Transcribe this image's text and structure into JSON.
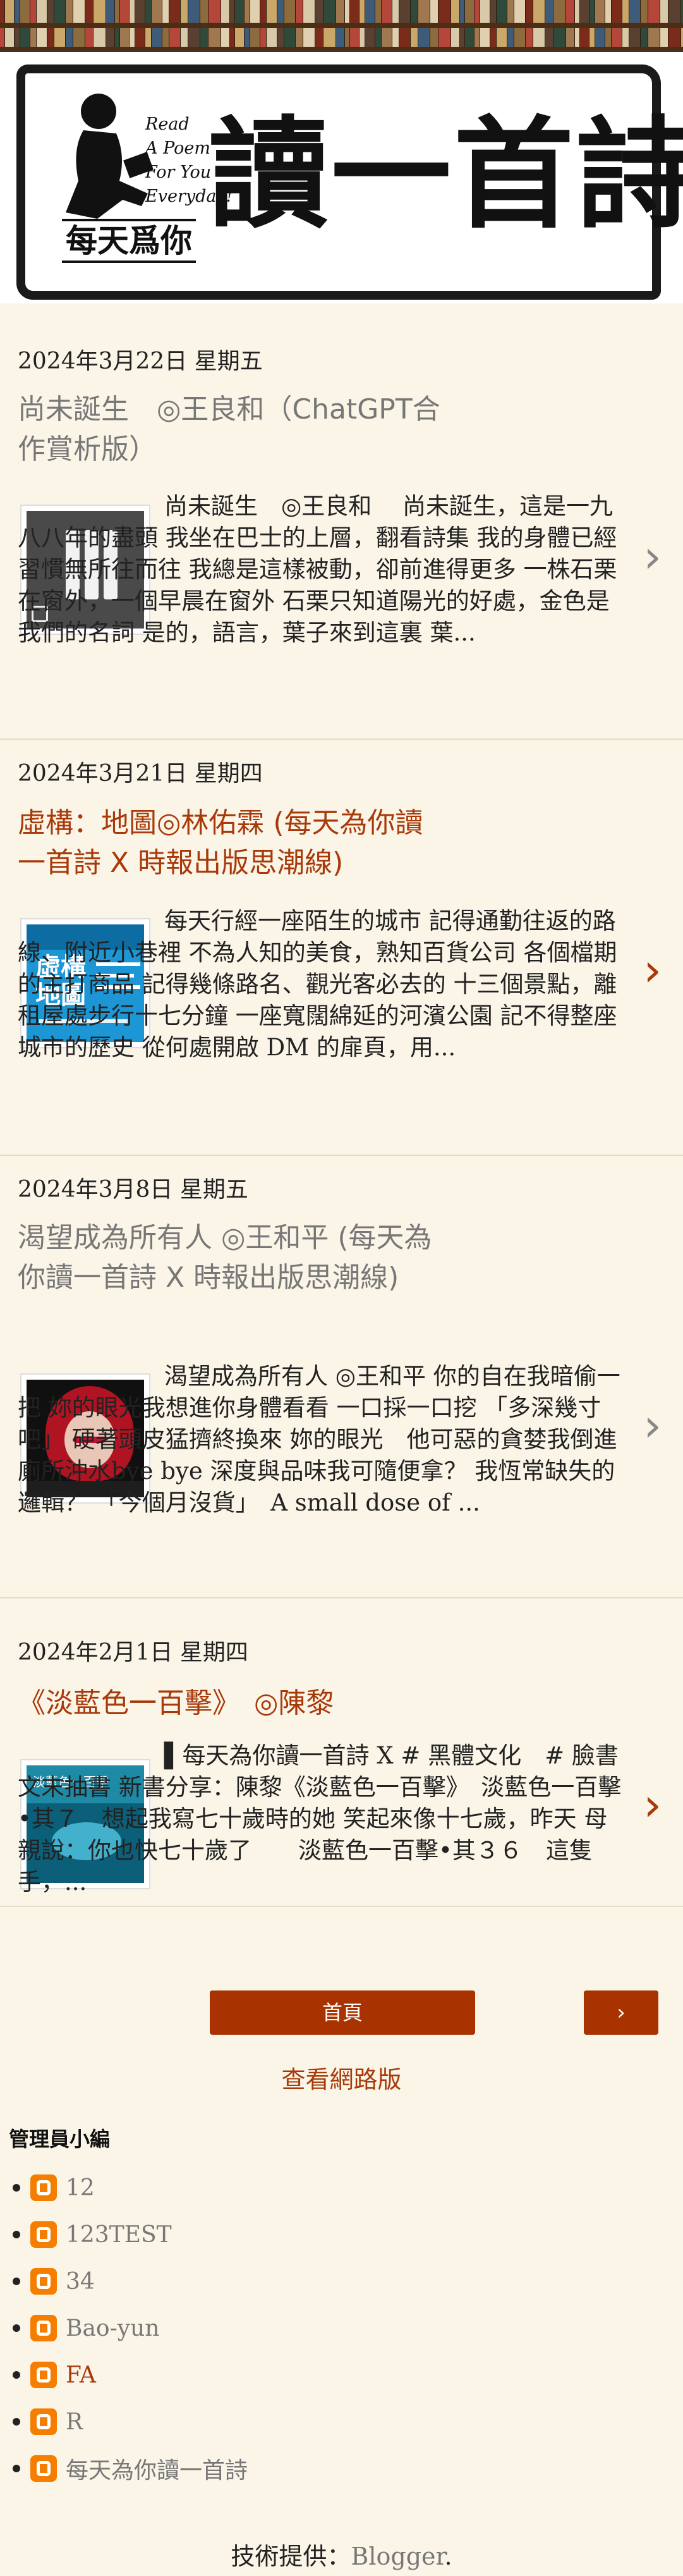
{
  "header": {
    "poem_lines": [
      "Read",
      "A Poem",
      "For You",
      "Everyday!"
    ],
    "title_big": "讀一首詩",
    "title_sub": "每天爲你"
  },
  "posts": [
    {
      "date": "2024年3月22日 星期五",
      "title": "尚未誕生　◎王良和（ChatGPT合作賞析版）",
      "snippet": "尚未誕生　◎王良和　 尚未誕生，這是一九八八年的盡頭 我坐在巴士的上層，翻看詩集 我的身體已經習慣無所往而往 我總是這樣被動，卻前進得更多 一株石栗在窗外，一個早晨在窗外 石栗只知道陽光的好處，金色是我們的名詞 是的，語言，葉子來到這裏 葉..."
    },
    {
      "date": "2024年3月21日 星期四",
      "title": "虛構：地圖◎林佑霖 (每天為你讀一首詩 X 時報出版思潮線)",
      "snippet": "每天行經一座陌生的城市 記得通勤往返的路線、附近小巷裡 不為人知的美食，熟知百貨公司 各個檔期的主打商品 記得幾條路名、觀光客必去的 十三個景點，離租屋處步行十七分鐘 一座寬闊綿延的河濱公園 記不得整座城市的歷史 從何處開啟 DM 的扉頁，用..."
    },
    {
      "date": "2024年3月8日 星期五",
      "title": "渴望成為所有人 ◎王和平 (每天為你讀一首詩 X 時報出版思潮線)",
      "snippet": "渴望成為所有人 ◎王和平 你的自在我暗偷一把 妳的眼光我想進你身體看看 一口採一口挖 「多深幾寸吧」 硬著頭皮猛擠終換來 妳的眼光　他可惡的貪婪我倒進廁所沖水bye bye 深度與品味我可隨便拿？ 我恆常缺失的邏輯？ 「今個月沒貨」　A small dose of ..."
    },
    {
      "date": "2024年2月1日 星期四",
      "title": "《淡藍色一百擊》　◎陳黎",
      "snippet": "▌每天為你讀一首詩 X # 黑體文化　# 臉書文末抽書 新書分享：陳黎《淡藍色一百擊》　淡藍色一百擊•其７　想起我寫七十歲時的她 笑起來像十七歲，昨天 母親說：你也快七十歲了　　淡藍色一百擊•其３６　這隻手，..."
    }
  ],
  "nav": {
    "home_label": "首頁",
    "next_label": "›",
    "web_version_label": "查看網路版"
  },
  "profiles": {
    "section_title": "管理員小編",
    "items": [
      "12",
      "123TEST",
      "34",
      "Bao-yun",
      "FA",
      "R",
      "每天為你讀一首詩"
    ]
  },
  "footer": {
    "powered_by": "技術提供：",
    "powered_link": "Blogger",
    "period": "."
  },
  "colors": {
    "accent": "#a83200",
    "title_red": "#a83a0a",
    "title_grey": "#777777",
    "background": "#fbf5e8",
    "blogger_orange": "#f57d00"
  }
}
